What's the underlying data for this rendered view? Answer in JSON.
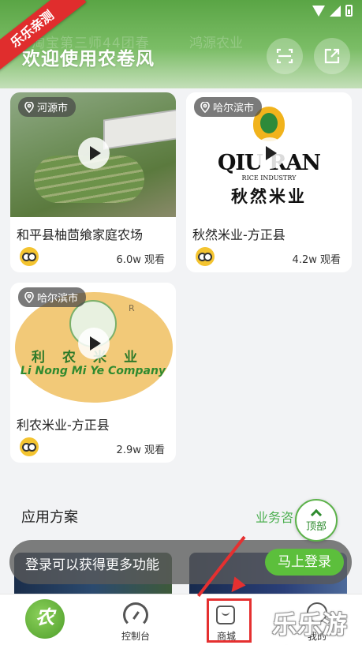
{
  "header": {
    "welcome": "欢迎使用农卷风",
    "bg_text_left": "淘宝第三师44团春",
    "bg_text_right": "鸿源农业",
    "ribbon": "乐乐亲测"
  },
  "cards": [
    {
      "location": "河源市",
      "title": "和平县柚茴飨家庭农场",
      "views": "6.0w 观看"
    },
    {
      "location": "哈尔滨市",
      "title": "秋然米业-方正县",
      "views": "4.2w 观看",
      "logo": {
        "en": "QIU RAN",
        "sub": "RICE INDUSTRY",
        "cn": "秋然米业"
      }
    },
    {
      "location": "哈尔滨市",
      "title": "利农米业-方正县",
      "views": "2.9w 观看",
      "logo": {
        "cn": "利农米业",
        "en": "Li Nong Mi Ye Company",
        "mark": "R"
      }
    }
  ],
  "section": {
    "title": "应用方案",
    "link": "业务咨"
  },
  "top_button": "顶部",
  "login_banner": {
    "text": "登录可以获得更多功能",
    "button": "马上登录"
  },
  "tabs": [
    {
      "label": "",
      "logo": "农"
    },
    {
      "label": "控制台"
    },
    {
      "label": "商城"
    },
    {
      "label": "我的"
    }
  ],
  "watermark": "乐乐游戏",
  "colors": {
    "accent": "#5cbf3c",
    "highlight": "#e53030"
  },
  "icons": {
    "scan": "scan-icon",
    "share": "share-icon",
    "location": "location-pin-icon",
    "play": "play-icon",
    "owl": "owl-avatar-icon",
    "console": "gauge-icon",
    "mall": "shopping-bag-icon",
    "me": "user-icon"
  }
}
